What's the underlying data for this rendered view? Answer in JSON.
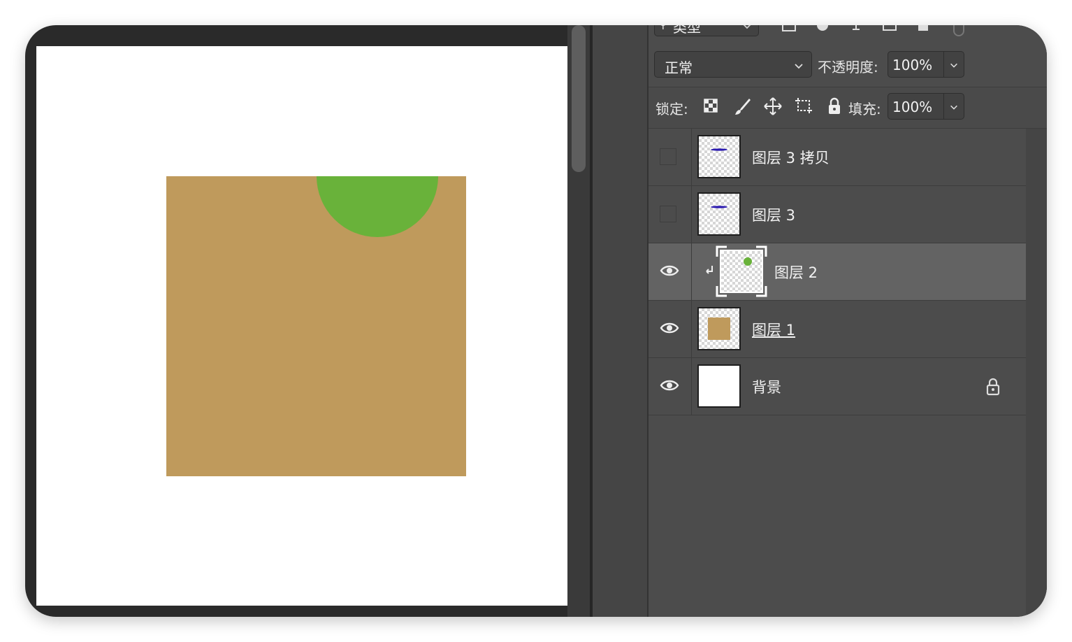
{
  "layers_panel": {
    "filter_label": "类型",
    "blend_mode": "正常",
    "opacity_label": "不透明度:",
    "opacity_value": "100%",
    "lock_label": "锁定:",
    "fill_label": "填充:",
    "fill_value": "100%",
    "layers": [
      {
        "name": "图层 3 拷贝",
        "visible": false
      },
      {
        "name": "图层 3",
        "visible": false
      },
      {
        "name": "图层 2",
        "visible": true,
        "selected": true,
        "clipped": true
      },
      {
        "name": "图层 1",
        "visible": true
      },
      {
        "name": "背景",
        "visible": true,
        "locked": true
      }
    ]
  },
  "canvas": {
    "rect_color": "#bf9a5c",
    "circle_color": "#69b23a"
  }
}
